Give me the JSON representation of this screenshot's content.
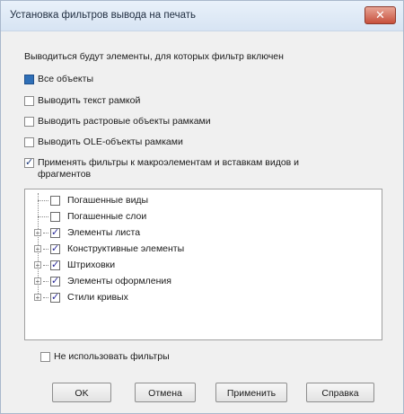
{
  "window": {
    "title": "Установка фильтров вывода на печать",
    "close_label": "✕"
  },
  "heading": "Выводиться будут элементы, для которых фильтр включен",
  "options": [
    {
      "label": "Все объекты",
      "state": "indeterminate"
    },
    {
      "label": "Выводить текст рамкой",
      "state": "unchecked"
    },
    {
      "label": "Выводить растровые объекты рамками",
      "state": "unchecked"
    },
    {
      "label": "Выводить OLE-объекты рамками",
      "state": "unchecked"
    },
    {
      "label": "Применять фильтры к макроэлементам и вставкам видов и фрагментов",
      "state": "checked"
    }
  ],
  "tree": [
    {
      "label": "Погашенные виды",
      "expandable": false,
      "checked": false
    },
    {
      "label": "Погашенные слои",
      "expandable": false,
      "checked": false
    },
    {
      "label": "Элементы листа",
      "expandable": true,
      "checked": true
    },
    {
      "label": "Конструктивные элементы",
      "expandable": true,
      "checked": true
    },
    {
      "label": "Штриховки",
      "expandable": true,
      "checked": true
    },
    {
      "label": "Элементы оформления",
      "expandable": true,
      "checked": true
    },
    {
      "label": "Стили кривых",
      "expandable": true,
      "checked": true
    }
  ],
  "no_filters_label": "Не использовать фильтры",
  "buttons": {
    "ok": "OK",
    "cancel": "Отмена",
    "apply": "Применить",
    "help": "Справка"
  },
  "colors": {
    "title_bg": "#dce7f4",
    "close_bg": "#c7503c",
    "accent_checkbox": "#2f6fb7"
  }
}
